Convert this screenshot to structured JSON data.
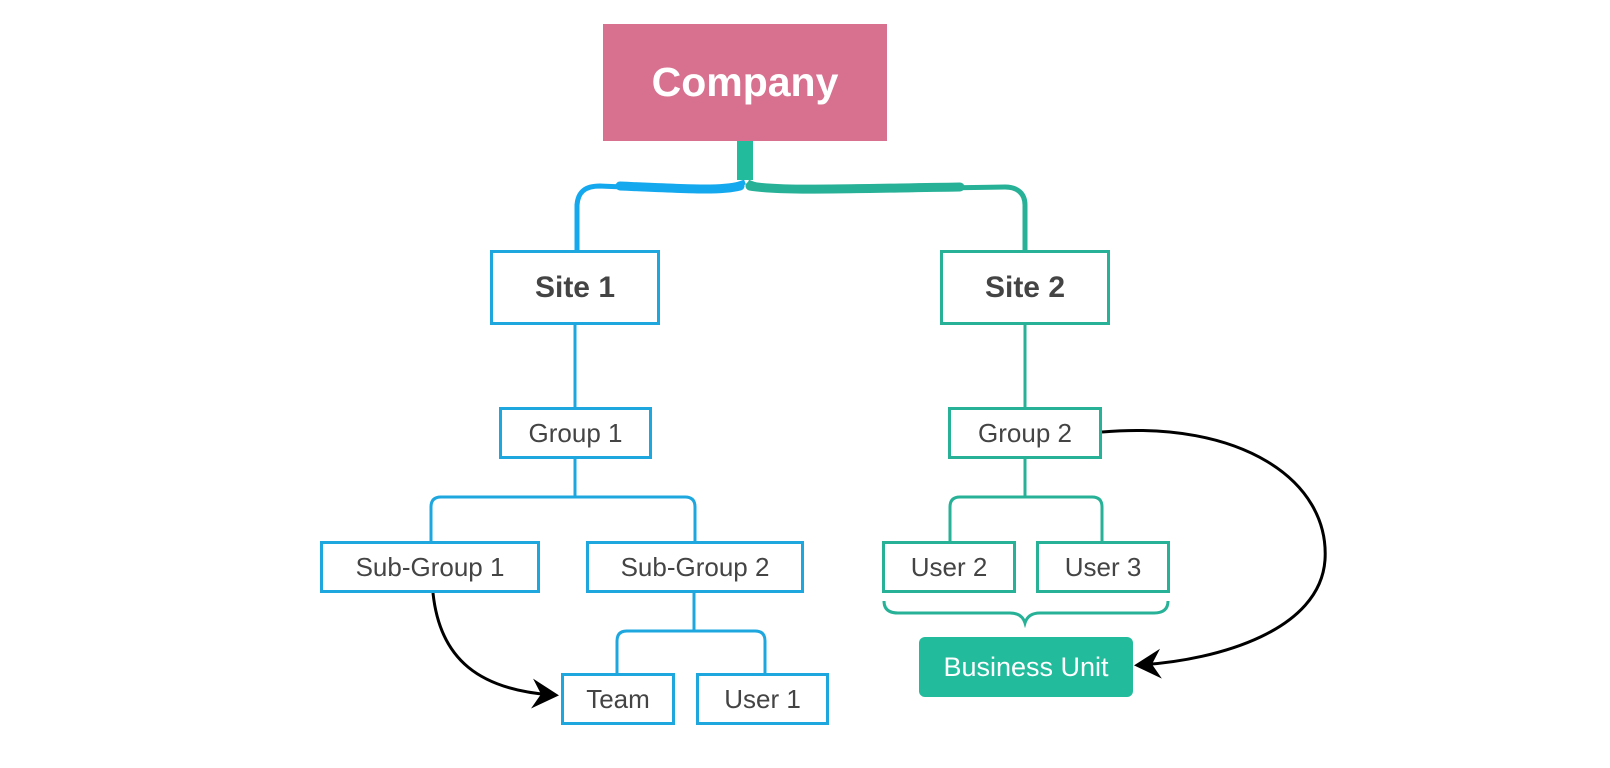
{
  "diagram": {
    "type": "org-chart",
    "colors": {
      "root_fill": "#d7718f",
      "branch_blue": "#1ea7df",
      "branch_teal": "#27b197",
      "business_unit_fill": "#22bc9d",
      "arrow": "#000000",
      "text_dark": "#444444",
      "text_light": "#ffffff"
    },
    "nodes": {
      "company": "Company",
      "site1": "Site 1",
      "site2": "Site 2",
      "group1": "Group 1",
      "group2": "Group 2",
      "subgroup1": "Sub-Group 1",
      "subgroup2": "Sub-Group 2",
      "team": "Team",
      "user1": "User 1",
      "user2": "User 2",
      "user3": "User 3",
      "business_unit": "Business Unit"
    },
    "hierarchy": [
      {
        "parent": "Company",
        "child": "Site 1"
      },
      {
        "parent": "Company",
        "child": "Site 2"
      },
      {
        "parent": "Site 1",
        "child": "Group 1"
      },
      {
        "parent": "Group 1",
        "child": "Sub-Group 1"
      },
      {
        "parent": "Group 1",
        "child": "Sub-Group 2"
      },
      {
        "parent": "Sub-Group 2",
        "child": "Team"
      },
      {
        "parent": "Sub-Group 2",
        "child": "User 1"
      },
      {
        "parent": "Site 2",
        "child": "Group 2"
      },
      {
        "parent": "Group 2",
        "child": "User 2"
      },
      {
        "parent": "Group 2",
        "child": "User 3"
      }
    ],
    "relationships": [
      {
        "from": "Sub-Group 1",
        "to": "Team",
        "style": "curved-arrow"
      },
      {
        "from": "Group 2",
        "to": "Business Unit",
        "style": "curved-arrow"
      }
    ],
    "summary": {
      "members": [
        "User 2",
        "User 3"
      ],
      "label": "Business Unit",
      "style": "brace"
    }
  }
}
